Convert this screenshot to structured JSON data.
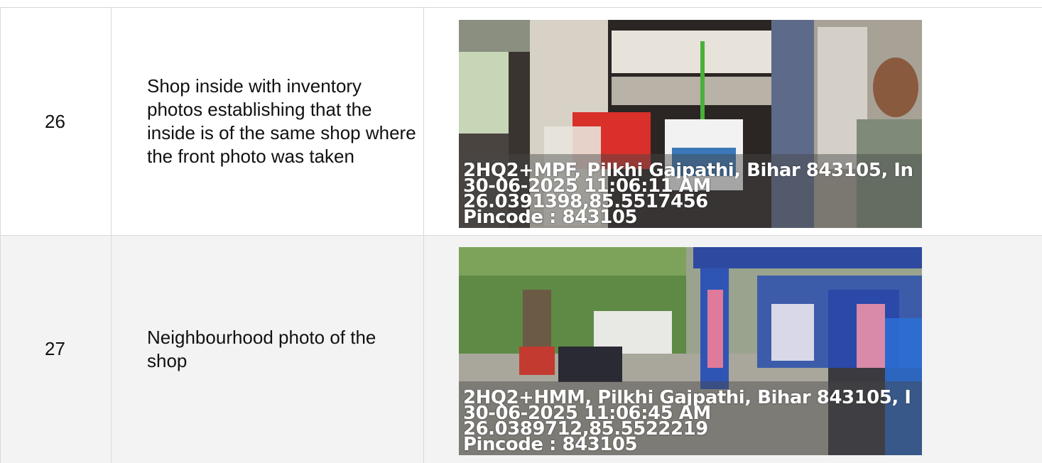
{
  "rows": [
    {
      "number": "26",
      "description": "Shop inside with inventory photos establishing that the inside is of the same shop where the front photo was taken",
      "photo": {
        "address": "2HQ2+MPF, Pilkhi Gajpathi, Bihar 843105, In",
        "datetime": "30-06-2025 11:06:11 AM",
        "coordinates": "26.0391398,85.5517456",
        "pincode": "Pincode : 843105"
      }
    },
    {
      "number": "27",
      "description": "Neighbourhood photo of the shop",
      "photo": {
        "address": "2HQ2+HMM, Pilkhi Gajpathi, Bihar 843105, I",
        "datetime": "30-06-2025 11:06:45 AM",
        "coordinates": "26.0389712,85.5522219",
        "pincode": "Pincode : 843105"
      }
    }
  ]
}
